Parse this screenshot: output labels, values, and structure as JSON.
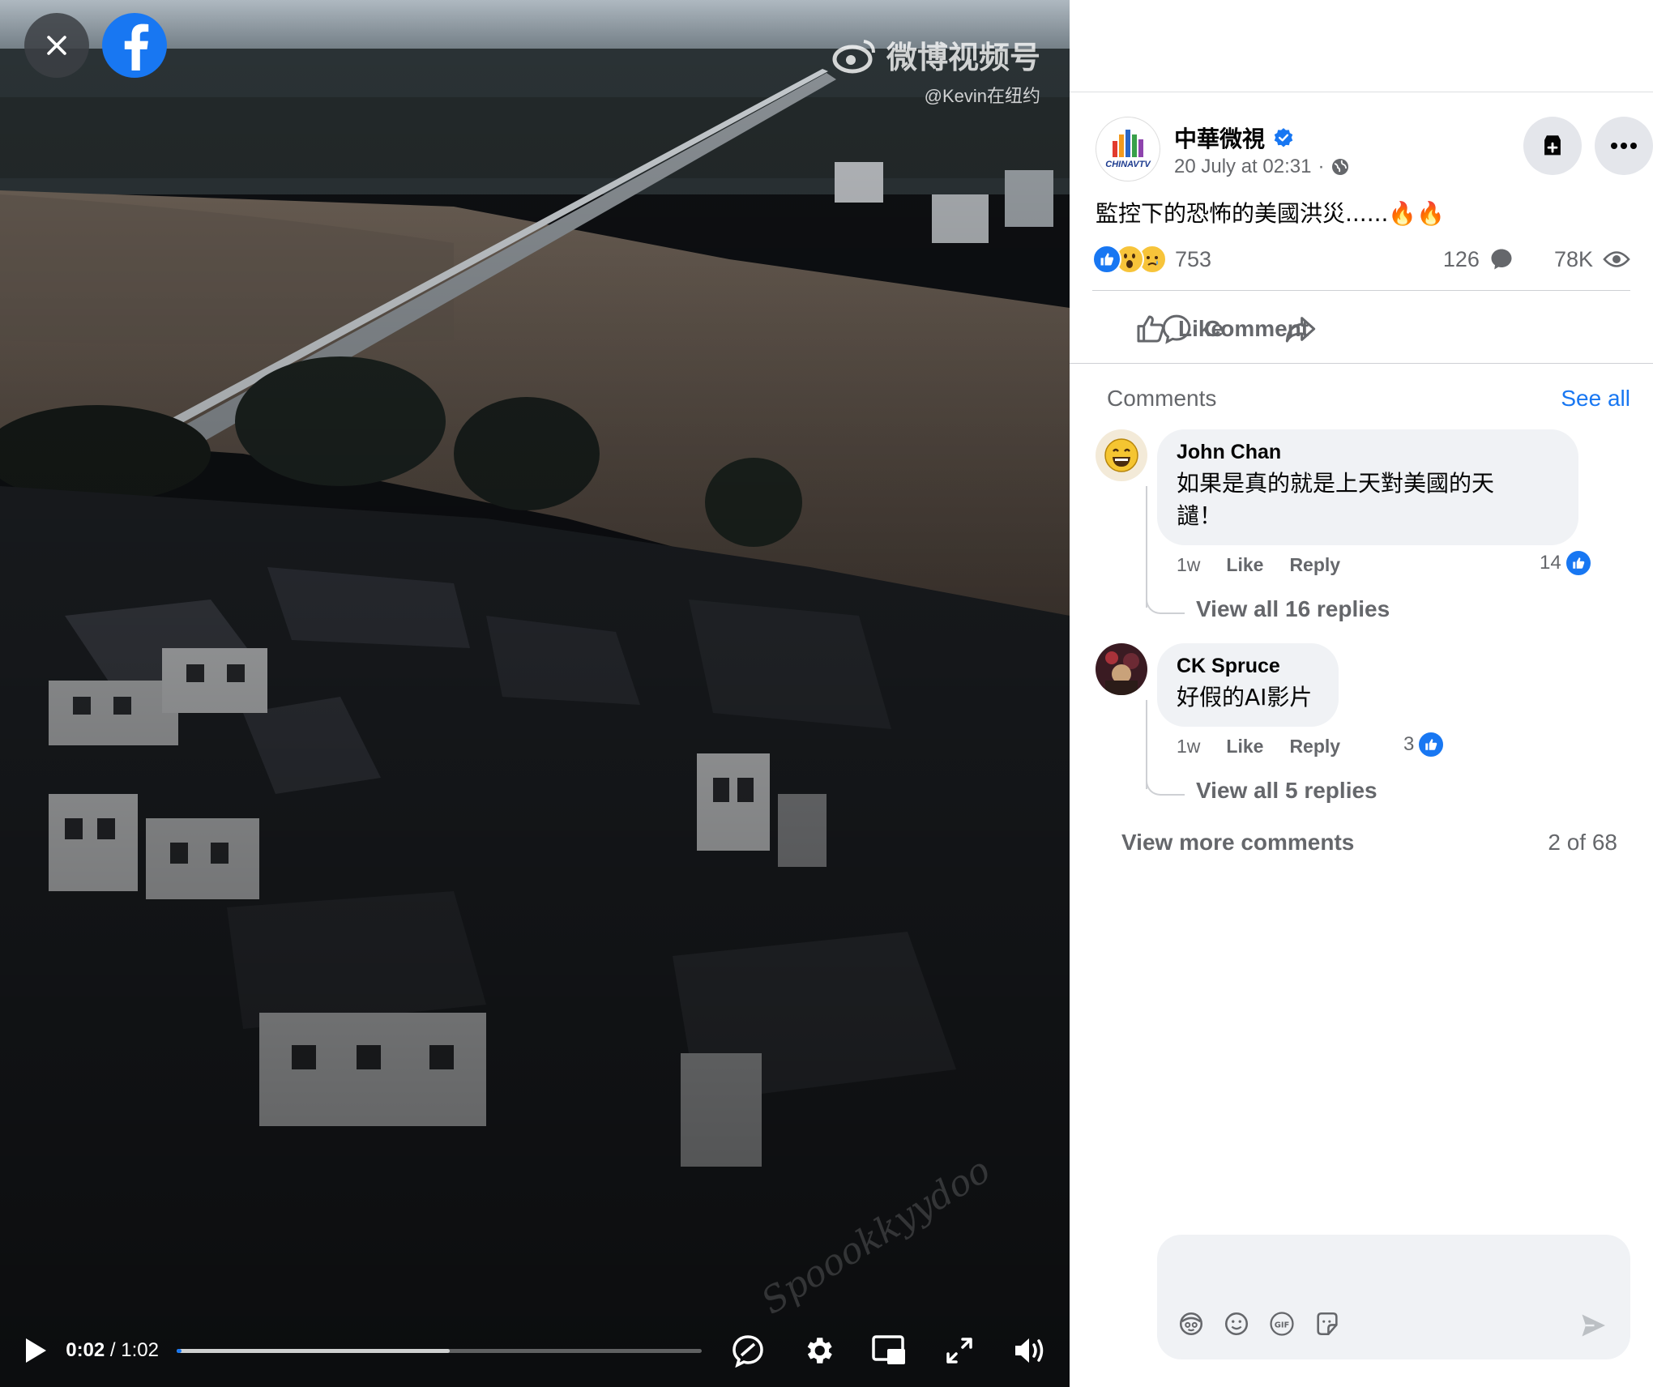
{
  "video": {
    "watermark_main": "微博视频号",
    "watermark_sub": "@Kevin在纽约",
    "watermark2": "Spoookkyydoo",
    "time_current": "0:02",
    "time_sep": " / ",
    "time_total": "1:02",
    "progress_played_fraction": 0.01,
    "progress_buffered_fraction": 0.52,
    "icons": [
      "close-icon",
      "facebook-logo-icon",
      "play-icon",
      "captions-icon",
      "settings-icon",
      "picture-in-picture-icon",
      "fullscreen-icon",
      "volume-icon"
    ]
  },
  "post": {
    "page_name": "中華微視",
    "avatar_text": "CHINAVTV",
    "date": "20 July at 02:31",
    "dot": "·",
    "text": "監控下的恐怖的美國洪災......🔥🔥",
    "reaction_count": "753",
    "comment_count": "126",
    "view_count": "78K"
  },
  "actions": {
    "like": "Like",
    "comment": "Comment"
  },
  "comments_section": {
    "label": "Comments",
    "see_all": "See all",
    "items": [
      {
        "name": "John Chan",
        "text_line1": "如果是真的就是上天對美國的天",
        "text_line2": "譴！",
        "time": "1w",
        "like": "Like",
        "reply": "Reply",
        "likes": "14",
        "view_replies": "View all 16 replies"
      },
      {
        "name": "CK Spruce",
        "text_line1": "好假的AI影片",
        "time": "1w",
        "like": "Like",
        "reply": "Reply",
        "likes": "3",
        "view_replies": "View all 5 replies"
      }
    ],
    "view_more": "View more comments",
    "count": "2 of 68"
  },
  "composer": {
    "placeholder": ""
  },
  "colors": {
    "brand_blue": "#1877f2",
    "secondary_text": "#65676b",
    "bubble_bg": "#f0f2f5"
  }
}
